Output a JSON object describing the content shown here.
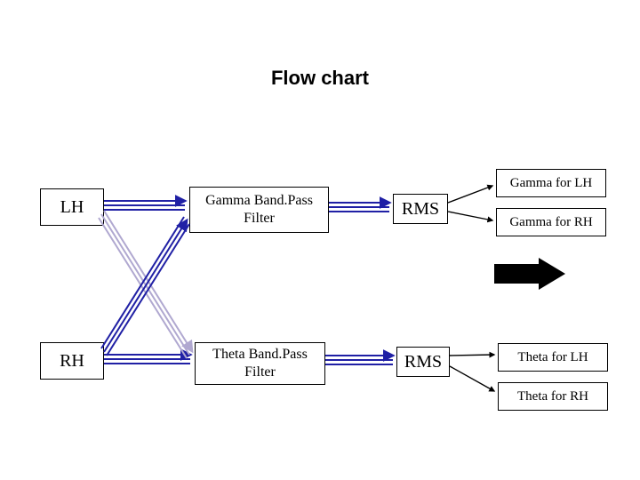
{
  "title": "Flow chart",
  "nodes": {
    "lh": "LH",
    "rh": "RH",
    "gamma_filter_line1": "Gamma Band.Pass",
    "gamma_filter_line2": "Filter",
    "theta_filter_line1": "Theta Band.Pass",
    "theta_filter_line2": "Filter",
    "rms1": "RMS",
    "rms2": "RMS",
    "gamma_for_lh": "Gamma for LH",
    "gamma_for_rh": "Gamma for RH",
    "theta_for_lh": "Theta for LH",
    "theta_for_rh": "Theta for RH"
  }
}
